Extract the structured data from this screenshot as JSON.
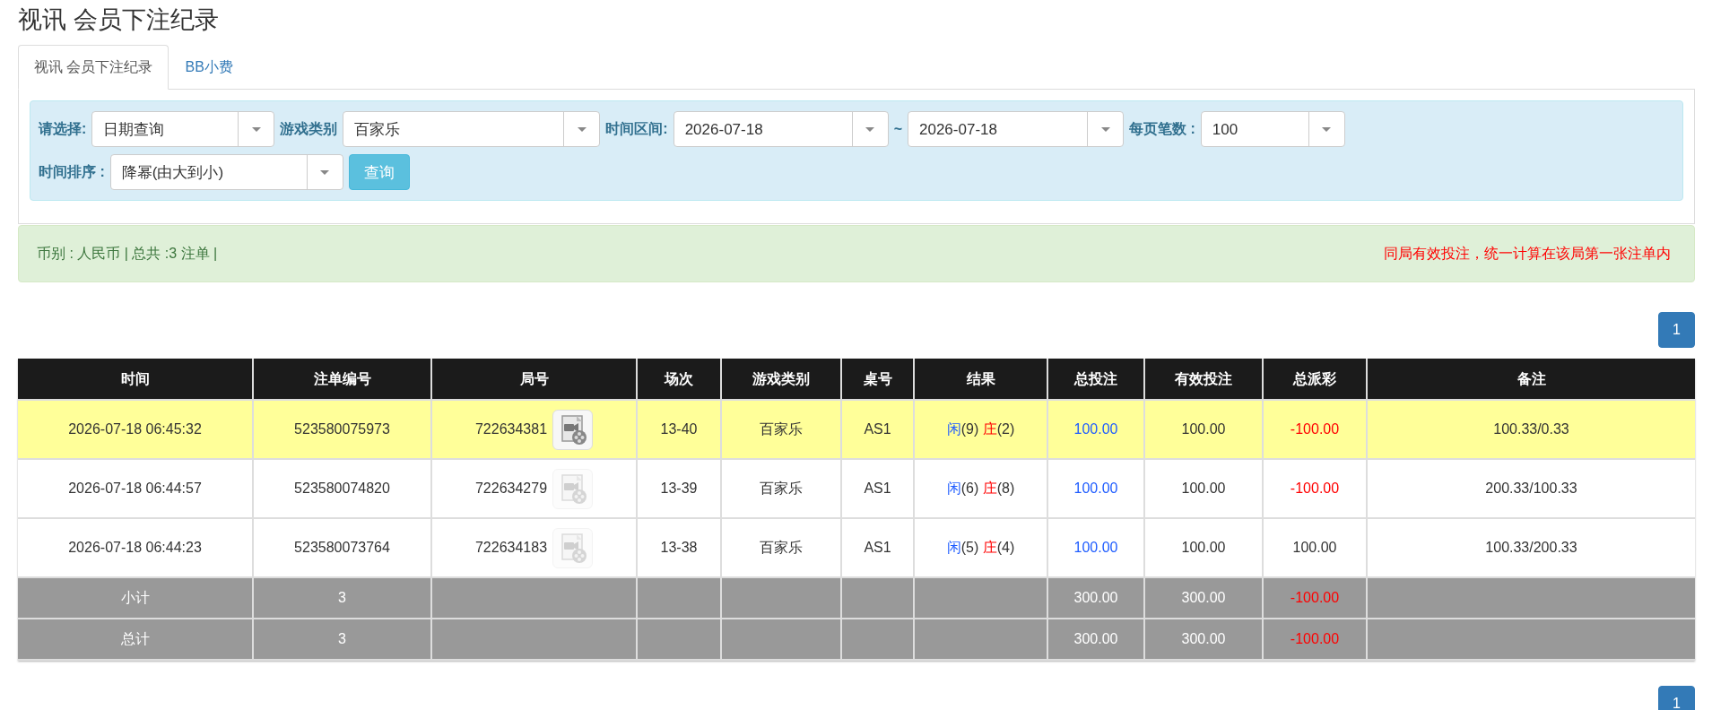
{
  "page_title": "视讯 会员下注纪录",
  "tabs": [
    {
      "label": "视讯 会员下注纪录",
      "selected": true
    },
    {
      "label": "BB小费",
      "selected": false
    }
  ],
  "filters": [
    [
      {
        "kind": "label",
        "text": "请选择:"
      },
      {
        "kind": "select",
        "value": "日期查询"
      },
      {
        "kind": "label",
        "text": "游戏类别"
      },
      {
        "kind": "select",
        "value": "百家乐"
      },
      {
        "kind": "label",
        "text": "时间区间:"
      },
      {
        "kind": "select",
        "value": "2026-07-18"
      },
      {
        "kind": "separator",
        "text": "~"
      },
      {
        "kind": "select",
        "value": "2026-07-18"
      },
      {
        "kind": "label",
        "text": "每页笔数 :"
      },
      {
        "kind": "select",
        "value": "100"
      }
    ],
    [
      {
        "kind": "label",
        "text": "时间排序 :"
      },
      {
        "kind": "select",
        "value": "降幂(由大到小)"
      },
      {
        "kind": "button",
        "text": "查询"
      }
    ]
  ],
  "summary": {
    "text": "币别 : 人民币 | 总共 :3 注单 |",
    "note": "同局有效投注，统一计算在该局第一张注单内"
  },
  "pagination_top": [
    {
      "label": "1",
      "selected": true
    }
  ],
  "pagination_bottom": [
    {
      "label": "1",
      "selected": true
    }
  ],
  "table": {
    "columns": [
      "时间",
      "注单编号",
      "局号",
      "场次",
      "游戏类别",
      "桌号",
      "结果",
      "总投注",
      "有效投注",
      "总派彩",
      "备注"
    ],
    "rows": [
      {
        "highlighted": true,
        "time": "2026-07-18 06:45:32",
        "bet_no": "523580075973",
        "round_no": "722634381",
        "video_available": true,
        "session": "13-40",
        "game": "百家乐",
        "table_no": "AS1",
        "result": {
          "player": "闲",
          "player_score": "(9)",
          "banker": "庄",
          "banker_score": "(2)"
        },
        "total_bet": "100.00",
        "valid_bet": "100.00",
        "payout": {
          "text": "-100.00",
          "negative": true
        },
        "note": "100.33/0.33"
      },
      {
        "highlighted": false,
        "time": "2026-07-18 06:44:57",
        "bet_no": "523580074820",
        "round_no": "722634279",
        "video_available": false,
        "session": "13-39",
        "game": "百家乐",
        "table_no": "AS1",
        "result": {
          "player": "闲",
          "player_score": "(6)",
          "banker": "庄",
          "banker_score": "(8)"
        },
        "total_bet": "100.00",
        "valid_bet": "100.00",
        "payout": {
          "text": "-100.00",
          "negative": true
        },
        "note": "200.33/100.33"
      },
      {
        "highlighted": false,
        "time": "2026-07-18 06:44:23",
        "bet_no": "523580073764",
        "round_no": "722634183",
        "video_available": false,
        "session": "13-38",
        "game": "百家乐",
        "table_no": "AS1",
        "result": {
          "player": "闲",
          "player_score": "(5)",
          "banker": "庄",
          "banker_score": "(4)"
        },
        "total_bet": "100.00",
        "valid_bet": "100.00",
        "payout": {
          "text": "100.00",
          "negative": false
        },
        "note": "100.33/200.33"
      }
    ],
    "totals": [
      {
        "label": "小计",
        "count": "3",
        "total_bet": "300.00",
        "valid_bet": "300.00",
        "payout": {
          "text": "-100.00",
          "negative": true
        }
      },
      {
        "label": "总计",
        "count": "3",
        "total_bet": "300.00",
        "valid_bet": "300.00",
        "payout": {
          "text": "-100.00",
          "negative": true
        }
      }
    ]
  }
}
